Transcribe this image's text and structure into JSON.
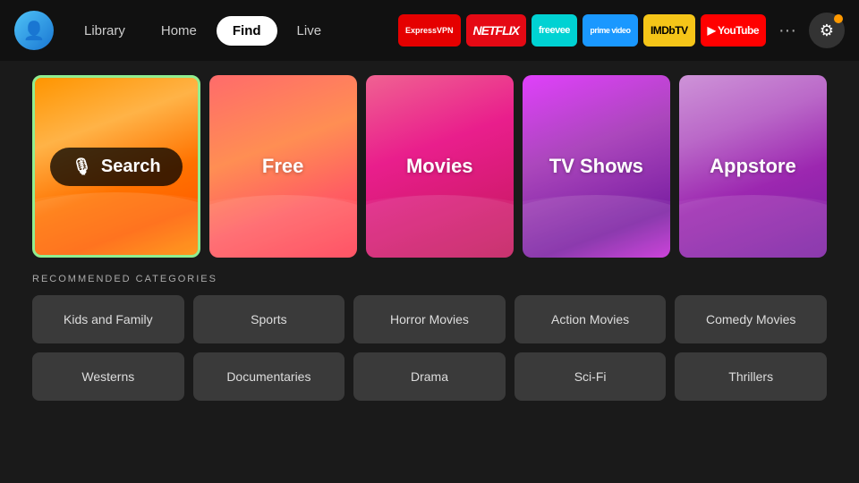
{
  "nav": {
    "library_label": "Library",
    "home_label": "Home",
    "find_label": "Find",
    "live_label": "Live",
    "active": "find"
  },
  "apps": [
    {
      "id": "expressvpn",
      "label": "ExpressVPN",
      "class": "expressvpn"
    },
    {
      "id": "netflix",
      "label": "NETFLIX",
      "class": "netflix"
    },
    {
      "id": "freevee",
      "label": "freevee",
      "class": "freevee"
    },
    {
      "id": "prime",
      "label": "prime video",
      "class": "prime"
    },
    {
      "id": "imdb",
      "label": "IMDbTV",
      "class": "imdb"
    },
    {
      "id": "youtube",
      "label": "▶ YouTube",
      "class": "youtube"
    }
  ],
  "tiles": [
    {
      "id": "search",
      "label": "Search",
      "type": "search"
    },
    {
      "id": "free",
      "label": "Free"
    },
    {
      "id": "movies",
      "label": "Movies"
    },
    {
      "id": "tvshows",
      "label": "TV Shows"
    },
    {
      "id": "appstore",
      "label": "Appstore"
    }
  ],
  "recommended": {
    "title": "RECOMMENDED CATEGORIES",
    "categories": [
      "Kids and Family",
      "Sports",
      "Horror Movies",
      "Action Movies",
      "Comedy Movies",
      "Westerns",
      "Documentaries",
      "Drama",
      "Sci-Fi",
      "Thrillers"
    ]
  }
}
